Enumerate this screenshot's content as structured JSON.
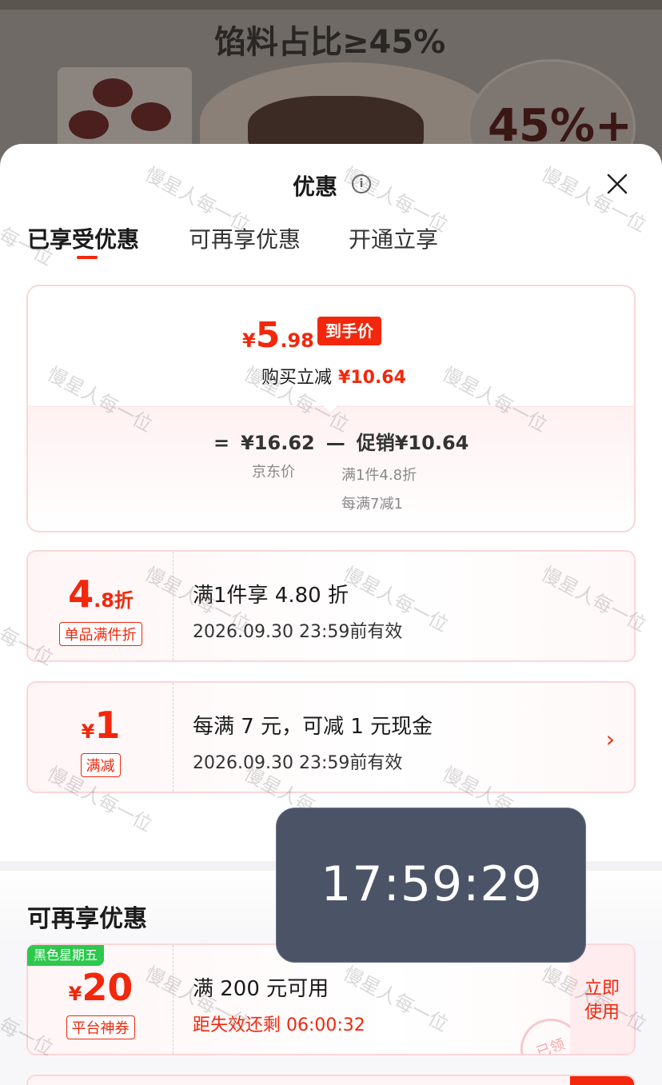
{
  "banner": {
    "headline": "馅料占比≥45%",
    "badge": "45%+"
  },
  "sheet": {
    "title": "优惠",
    "info_icon": "info-icon",
    "close_icon": "close-icon"
  },
  "tabs": [
    {
      "label": "已享受优惠",
      "active": true
    },
    {
      "label": "可再享优惠",
      "active": false
    },
    {
      "label": "开通立享",
      "active": false
    }
  ],
  "summary": {
    "currency": "¥",
    "price_int": "5",
    "price_dec": ".98",
    "price_tag": "到手价",
    "discount_label": "购买立减",
    "discount_value": "¥10.64",
    "eq": "=",
    "jd_price": "¥16.62",
    "minus": "—",
    "promo": "促销¥10.64",
    "jd_price_label": "京东价",
    "promo_detail_1": "满1件4.8折",
    "promo_detail_2": "每满7减1"
  },
  "coupons": [
    {
      "value_main": "4",
      "value_suffix": ".8折",
      "badge": "单品满件折",
      "title": "满1件享 4.80 折",
      "date": "2026.09.30 23:59前有效"
    },
    {
      "currency": "¥",
      "value_main": "1",
      "badge": "满减",
      "title": "每满 7 元，可减 1 元现金",
      "date": "2026.09.30 23:59前有效",
      "chevron": "›"
    }
  ],
  "more_section": {
    "title": "可再享优惠",
    "coupon": {
      "tag": "黑色星期五",
      "currency": "¥",
      "value_main": "20",
      "badge": "平台神券",
      "title": "满 200 元可用",
      "countdown": "距失效还剩 06:00:32",
      "use_label_1": "立即",
      "use_label_2": "使用",
      "stamp": "已领"
    }
  },
  "clock": {
    "time": "17:59:29"
  },
  "watermark": "慢星人每一位",
  "colors": {
    "accent": "#f2270c",
    "tag_green": "#2dc84d",
    "clock_bg": "#4b5467"
  }
}
